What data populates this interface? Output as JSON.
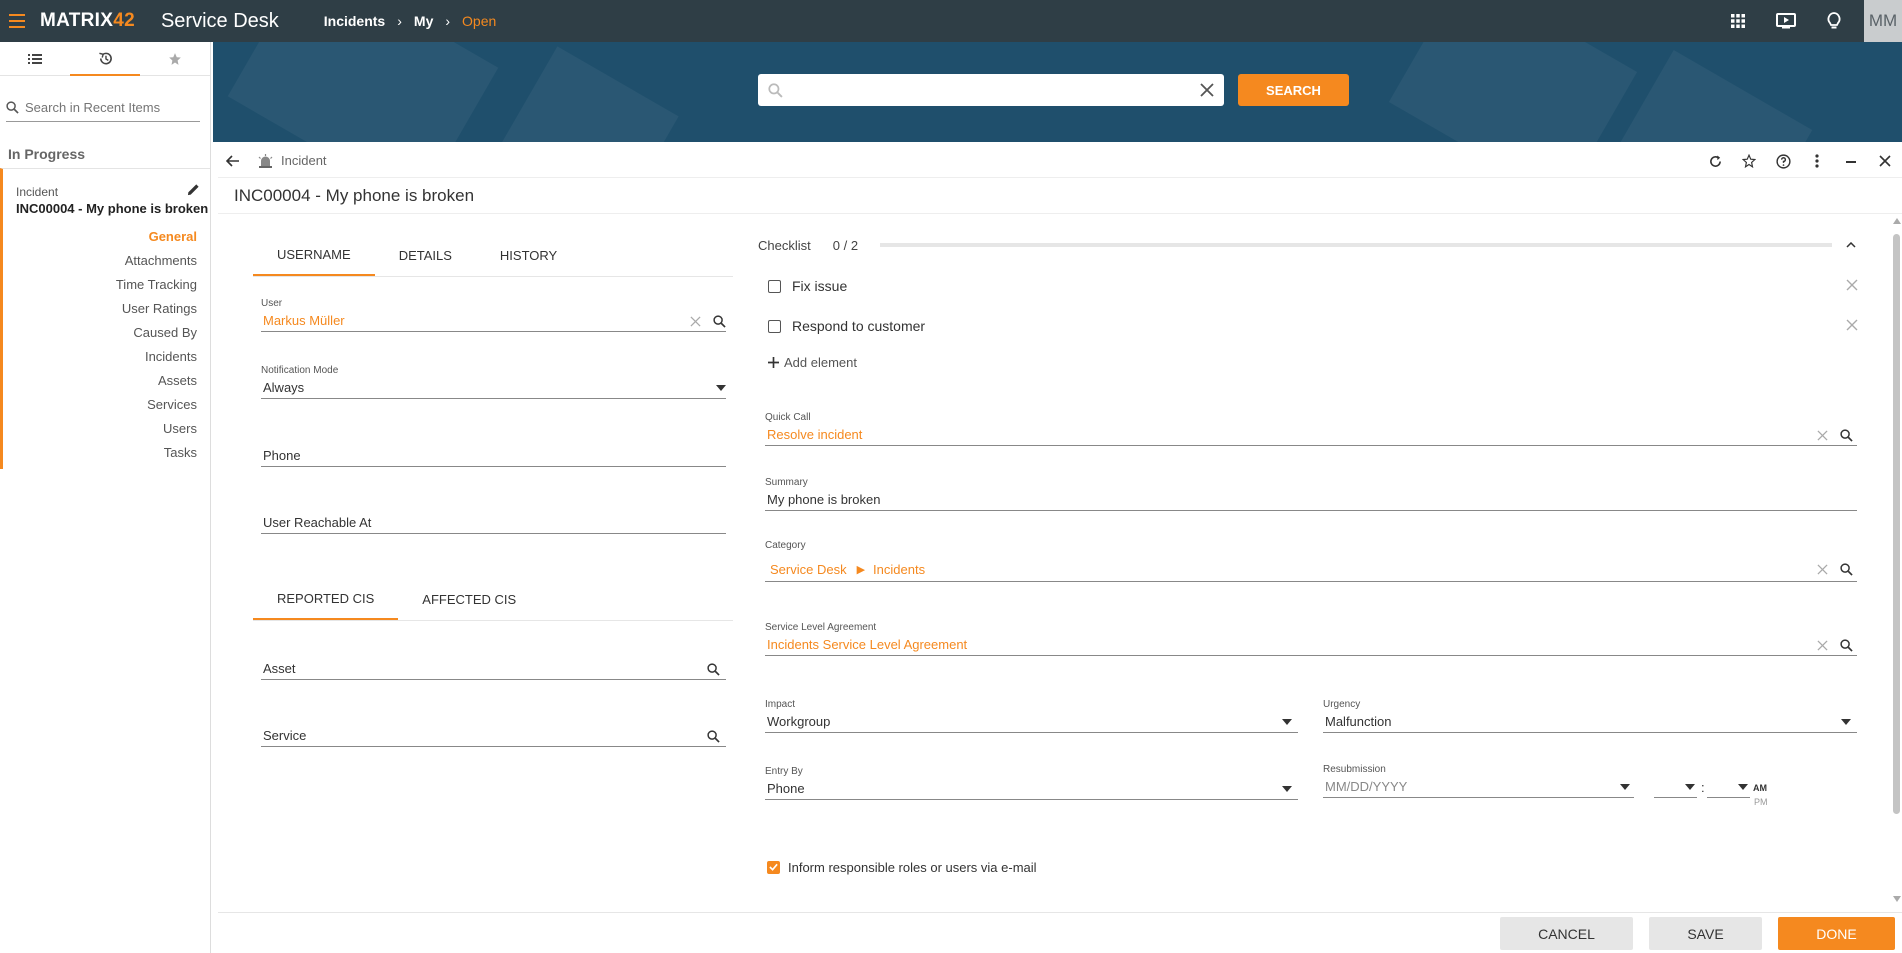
{
  "topbar": {
    "logo_main": "MATRIX",
    "logo_num": "42",
    "app_name": "Service Desk",
    "breadcrumb": [
      "Incidents",
      "My",
      "Open"
    ],
    "avatar_initials": "MM"
  },
  "sidebar": {
    "search_placeholder": "Search in Recent Items",
    "section_title": "In Progress",
    "recent_item": {
      "type": "Incident",
      "title": "INC00004 - My phone is broken"
    },
    "nav": [
      "General",
      "Attachments",
      "Time Tracking",
      "User Ratings",
      "Caused By",
      "Incidents",
      "Assets",
      "Services",
      "Users",
      "Tasks"
    ]
  },
  "banner": {
    "search_button": "SEARCH"
  },
  "dialog": {
    "type": "Incident",
    "title": "INC00004 - My phone is broken",
    "tabs_top": [
      "USERNAME",
      "DETAILS",
      "HISTORY"
    ],
    "user_label": "User",
    "user_value": "Markus Müller",
    "notification_label": "Notification Mode",
    "notification_value": "Always",
    "phone_placeholder": "Phone",
    "reachable_placeholder": "User Reachable At",
    "tabs_cis": [
      "REPORTED CIS",
      "AFFECTED CIS"
    ],
    "asset_placeholder": "Asset",
    "service_placeholder": "Service"
  },
  "checklist": {
    "label": "Checklist",
    "count": "0 / 2",
    "progress": 0,
    "items": [
      "Fix issue",
      "Respond to customer"
    ],
    "add_label": "Add element"
  },
  "form": {
    "quick_call_label": "Quick Call",
    "quick_call_value": "Resolve incident",
    "summary_label": "Summary",
    "summary_value": "My phone is broken",
    "category_label": "Category",
    "category_path": [
      "Service Desk",
      "Incidents"
    ],
    "sla_label": "Service Level Agreement",
    "sla_value": "Incidents Service Level Agreement",
    "impact_label": "Impact",
    "impact_value": "Workgroup",
    "urgency_label": "Urgency",
    "urgency_value": "Malfunction",
    "entry_by_label": "Entry By",
    "entry_by_value": "Phone",
    "resubmission_label": "Resubmission",
    "resubmission_placeholder": "MM/DD/YYYY",
    "time_sep": ":",
    "am": "AM",
    "pm": "PM",
    "inform_label": "Inform responsible roles or users via e-mail",
    "inform_checked": true
  },
  "footer": {
    "cancel": "CANCEL",
    "save": "SAVE",
    "done": "DONE"
  },
  "colors": {
    "accent": "#f5891f",
    "topbar": "#2f3e46",
    "banner": "#1f4f6c"
  }
}
